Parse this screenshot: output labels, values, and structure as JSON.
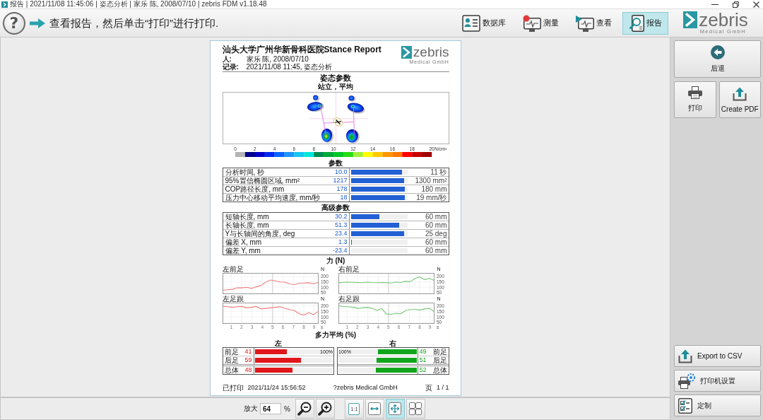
{
  "title_bar": {
    "title": "报告 | 2021/11/08 11:45:06 | 姿态分析 | 家乐 陈, 2008/07/10 | zebris FDM v1.18.48"
  },
  "toolbar": {
    "help": "?",
    "instruction": "查看报告，然后单击“打印”进行打印.",
    "nav": [
      {
        "kind": "database",
        "label": "数据库",
        "selected": false
      },
      {
        "kind": "measure",
        "label": "测量",
        "selected": false
      },
      {
        "kind": "view",
        "label": "查看",
        "selected": false
      },
      {
        "kind": "report",
        "label": "报告",
        "selected": true
      }
    ],
    "logo": {
      "name": "zebris",
      "tagline": "Medical GmbH"
    }
  },
  "report": {
    "title": "汕头大学广州华新骨科医院Stance Report",
    "logo": {
      "name": "zebris",
      "tagline": "Medical GmbH"
    },
    "meta": [
      {
        "label": "人:",
        "value": "家乐 陈, 2008/07/10"
      },
      {
        "label": "记录:",
        "value": "2021/11/08 11:45, 姿态分析"
      }
    ],
    "section_title": "姿态参数",
    "map_caption": "站立，平均",
    "scale": {
      "ticks": [
        "0",
        "2",
        "4",
        "6",
        "8",
        "10",
        "12",
        "14",
        "16",
        "18",
        "20"
      ],
      "unit": "N/cm²"
    },
    "parameters": {
      "title": "参数",
      "rows": [
        {
          "label": "分析时间, 秒",
          "value": "10.0",
          "level": 0.91,
          "max": "11 秒"
        },
        {
          "label": "95%置信椭圆区域, mm²",
          "value": "1217",
          "level": 0.94,
          "max": "1300 mm²"
        },
        {
          "label": "COP路径长度, mm",
          "value": "178",
          "level": 0.96,
          "max": "180 mm"
        },
        {
          "label": "压力中心移动平均速度, mm/秒",
          "value": "18",
          "level": 0.95,
          "max": "19 mm/秒"
        }
      ]
    },
    "advanced": {
      "title": "高级参数",
      "rows": [
        {
          "label": "短轴长度, mm",
          "value": "30.2",
          "level": 0.5,
          "max": "60 mm"
        },
        {
          "label": "长轴长度, mm",
          "value": "51.3",
          "level": 0.86,
          "max": "60 mm"
        },
        {
          "label": "Y与长轴间的角度, deg",
          "value": "23.4",
          "level": 0.94,
          "max": "25 deg"
        },
        {
          "label": "偏差 X, mm",
          "value": "1.3",
          "level": 0.02,
          "max": "60 mm"
        },
        {
          "label": "偏差 Y, mm",
          "value": "-23.4",
          "max": "60 mm"
        }
      ]
    },
    "force": {
      "title": "力 (N)",
      "charts": [
        {
          "chart_data": {
            "type": "line",
            "title": "左前足",
            "ylabel": "N",
            "x": [
              0.2,
              0.66,
              1.12,
              1.58,
              2.04,
              2.5,
              2.96,
              3.42,
              3.88,
              4.34,
              4.8,
              5.26,
              5.72,
              6.18,
              6.64,
              7.1,
              7.56,
              8.02,
              8.48,
              8.94,
              9.4
            ],
            "series": [
              {
                "color": "#f08080",
                "values": [
                  75,
                  78,
                  82,
                  96,
                  95,
                  100,
                  90,
                  105,
                  118,
                  148,
                  168,
                  160,
                  150,
                  148,
                  132,
                  125,
                  138,
                  140,
                  142,
                  132,
                  145
                ]
              }
            ],
            "xlim": [
              0.2,
              9.4
            ],
            "ylim": [
              40,
              230
            ],
            "yticks": [
              50,
              100,
              150,
              200
            ],
            "grid": true,
            "ref_lines": [
              {
                "axis": "x",
                "value": 5
              }
            ]
          }
        },
        {
          "chart_data": {
            "type": "line",
            "title": "右前足",
            "ylabel": "N",
            "x": [
              0.2,
              0.66,
              1.12,
              1.58,
              2.04,
              2.5,
              2.96,
              3.42,
              3.88,
              4.34,
              4.8,
              5.26,
              5.72,
              6.18,
              6.64,
              7.1,
              7.56,
              8.02,
              8.48,
              8.94,
              9.4
            ],
            "series": [
              {
                "color": "#78c878",
                "values": [
                  142,
                  146,
                  148,
                  147,
                  145,
                  143,
                  148,
                  145,
                  143,
                  145,
                  142,
                  140,
                  148,
                  145,
                  155,
                  152,
                  182,
                  195,
                  172,
                  183,
                  165
                ]
              }
            ],
            "xlim": [
              0.2,
              9.4
            ],
            "ylim": [
              40,
              230
            ],
            "yticks": [
              50,
              100,
              150,
              200
            ],
            "grid": true,
            "ref_lines": [
              {
                "axis": "x",
                "value": 5
              }
            ]
          }
        },
        {
          "chart_data": {
            "type": "line",
            "title": "左足跟",
            "ylabel": "N",
            "xlabel": "s",
            "x": [
              0.2,
              0.66,
              1.12,
              1.58,
              2.04,
              2.5,
              2.96,
              3.42,
              3.88,
              4.34,
              4.8,
              5.26,
              5.72,
              6.18,
              6.64,
              7.1,
              7.56,
              8.02,
              8.48,
              8.94,
              9.4
            ],
            "series": [
              {
                "color": "#f08080",
                "values": [
                  200,
                  195,
                  190,
                  195,
                  198,
                  185,
                  190,
                  198,
                  175,
                  180,
                  185,
                  190,
                  195,
                  180,
                  170,
                  160,
                  130,
                  118,
                  140,
                  122,
                  152
                ]
              }
            ],
            "xlim": [
              0.2,
              9.4
            ],
            "ylim": [
              40,
              230
            ],
            "xticks": [
              1,
              2,
              3,
              4,
              5,
              6,
              7,
              8,
              9
            ],
            "yticks": [
              50,
              100,
              150,
              200
            ],
            "grid": true,
            "ref_lines": [
              {
                "axis": "x",
                "value": 5
              }
            ]
          }
        },
        {
          "chart_data": {
            "type": "line",
            "title": "右足跟",
            "ylabel": "N",
            "xlabel": "s",
            "x": [
              0.2,
              0.66,
              1.12,
              1.58,
              2.04,
              2.5,
              2.96,
              3.42,
              3.88,
              4.34,
              4.8,
              5.26,
              5.72,
              6.18,
              6.64,
              7.1,
              7.56,
              8.02,
              8.48,
              8.94,
              9.4
            ],
            "series": [
              {
                "color": "#78c878",
                "values": [
                  205,
                  195,
                  195,
                  190,
                  180,
                  185,
                  190,
                  180,
                  162,
                  178,
                  128,
                  125,
                  135,
                  130,
                  160,
                  170,
                  170,
                  165,
                  175,
                  180,
                  150
                ]
              }
            ],
            "xlim": [
              0.2,
              9.4
            ],
            "ylim": [
              40,
              230
            ],
            "xticks": [
              1,
              2,
              3,
              4,
              5,
              6,
              7,
              8,
              9
            ],
            "yticks": [
              50,
              100,
              150,
              200
            ],
            "grid": true,
            "ref_lines": [
              {
                "axis": "x",
                "value": 5
              }
            ]
          }
        }
      ]
    },
    "distribution": {
      "title": "多力平均 (%)",
      "sides": [
        {
          "kind": "left",
          "label": "左",
          "scale": "100%",
          "color": "#e0161b",
          "rows": [
            {
              "label": "前足",
              "value": "41",
              "level": 0.41
            },
            {
              "label": "后足",
              "value": "59",
              "level": 0.59
            },
            {
              "label": "总体",
              "value": "48",
              "level": 0.48
            }
          ]
        },
        {
          "kind": "right",
          "label": "右",
          "scale": "100%",
          "color": "#12a51c",
          "rows": [
            {
              "label": "前足",
              "value": "49",
              "level": 0.49
            },
            {
              "label": "后足",
              "value": "51",
              "level": 0.51
            },
            {
              "label": "总体",
              "value": "52",
              "level": 0.52
            }
          ]
        }
      ]
    },
    "footer": {
      "printed_label": "已打印",
      "printed_time": "2021/11/24 15:56:52",
      "copyright": "?zebris Medical GmbH",
      "page_label": "页",
      "page": "1 / 1"
    }
  },
  "zoom_bar": {
    "label": "放大",
    "value": "64",
    "unit": "%",
    "buttons": [
      {
        "kind": "zoom_out",
        "selected": false
      },
      {
        "kind": "zoom_in",
        "selected": false
      },
      {
        "kind": "actual_size",
        "label": "1:1",
        "selected": false
      },
      {
        "kind": "fit_width",
        "selected": false
      },
      {
        "kind": "fit_page",
        "selected": true
      },
      {
        "kind": "multi_page",
        "selected": false
      }
    ]
  },
  "side_panel": {
    "top": [
      {
        "kind": "back",
        "label": "后退"
      },
      {
        "kind": "print",
        "label": "打印"
      },
      {
        "kind": "pdf",
        "label": "Create PDF"
      }
    ],
    "bottom": [
      {
        "kind": "csv",
        "label": "Export to CSV"
      },
      {
        "kind": "printer_setup",
        "label": "打印机设置"
      },
      {
        "kind": "customize",
        "label": "定制"
      }
    ]
  }
}
